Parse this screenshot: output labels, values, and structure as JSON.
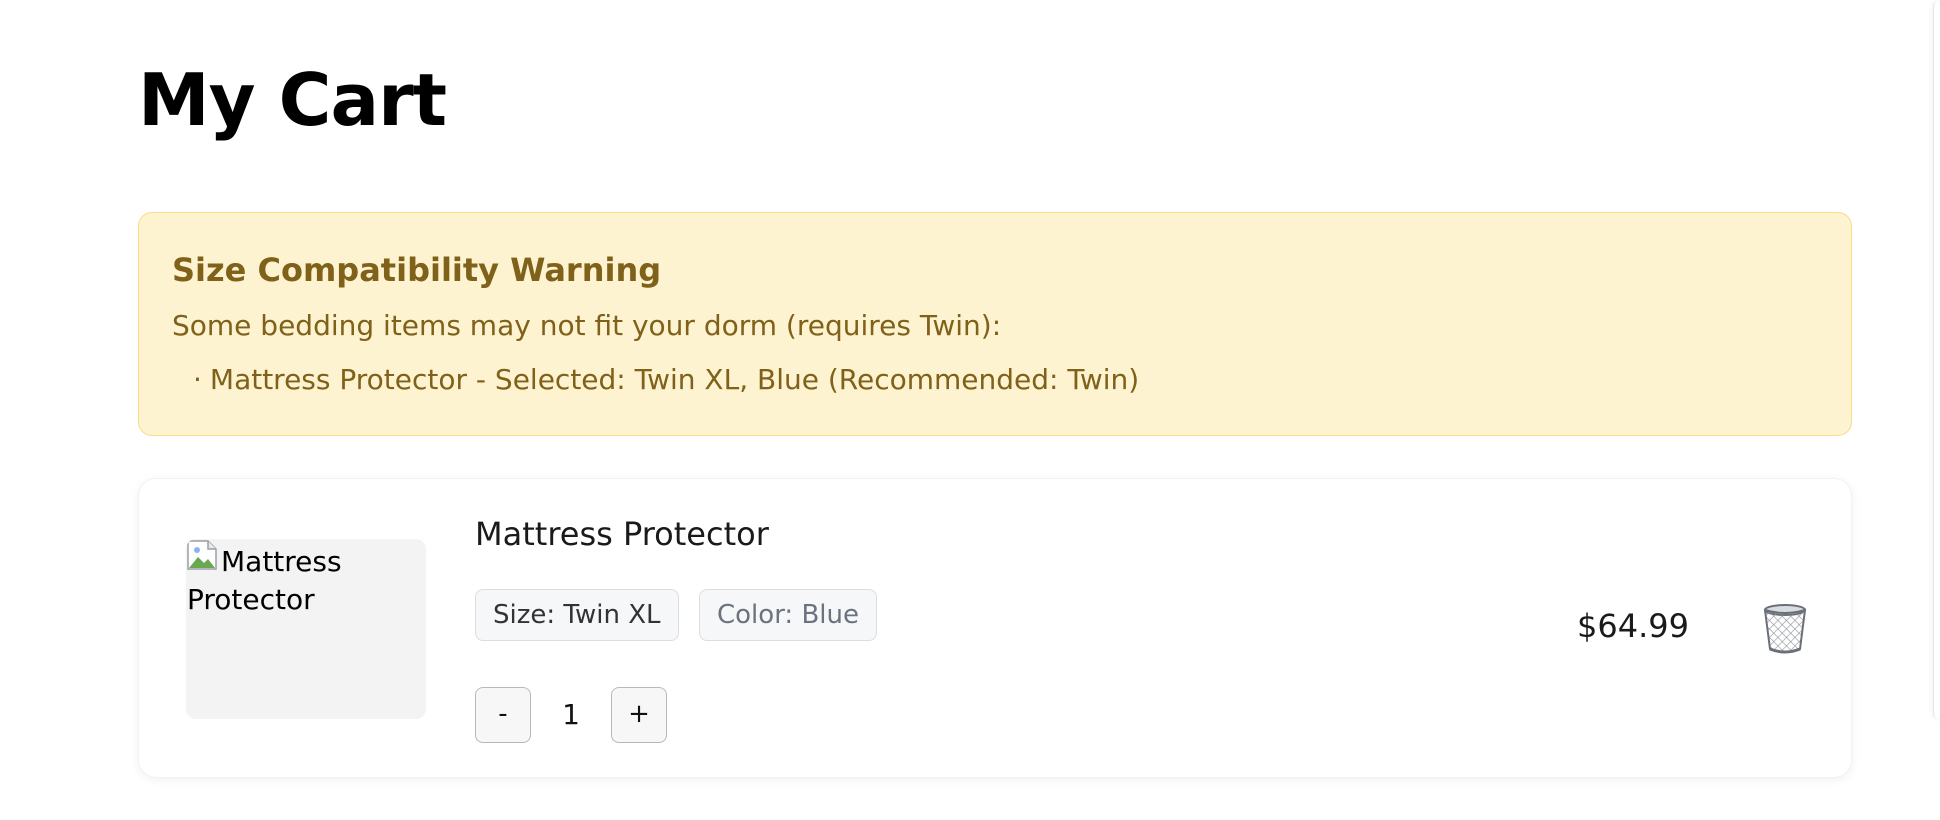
{
  "page": {
    "title": "My Cart"
  },
  "warning": {
    "title": "Size Compatibility Warning",
    "message": "Some bedding items may not fit your dorm (requires Twin):",
    "items": [
      {
        "bullet": "·",
        "text": "Mattress Protector - Selected: Twin XL, Blue (Recommended: Twin)"
      }
    ],
    "colors": {
      "background": "#fdf3d0",
      "border": "#f6dd88",
      "text": "#80611a"
    }
  },
  "cart": {
    "items": [
      {
        "name": "Mattress Protector",
        "image_alt": "Mattress Protector",
        "size_tag": "Size: Twin XL",
        "color_tag": "Color: Blue",
        "quantity": "1",
        "decrease_label": "-",
        "increase_label": "+",
        "price": "$64.99",
        "delete_icon": "trash-icon"
      }
    ]
  }
}
